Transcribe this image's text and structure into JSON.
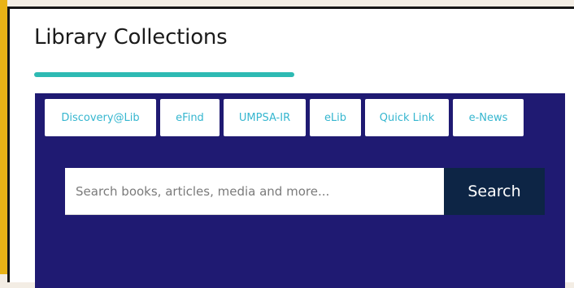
{
  "widget": {
    "title": "Library Collections"
  },
  "tabs": [
    {
      "label": "Discovery@Lib"
    },
    {
      "label": "eFind"
    },
    {
      "label": "UMPSA-IR"
    },
    {
      "label": "eLib"
    },
    {
      "label": "Quick Link"
    },
    {
      "label": "e-News"
    }
  ],
  "search": {
    "placeholder": "Search books, articles, media and more...",
    "button_label": "Search"
  },
  "colors": {
    "accent_yellow": "#e9b316",
    "underline_teal": "#2ebab3",
    "panel_navy": "#1f1a72",
    "tab_text_cyan": "#35b6cf",
    "button_dark": "#0d2545"
  }
}
